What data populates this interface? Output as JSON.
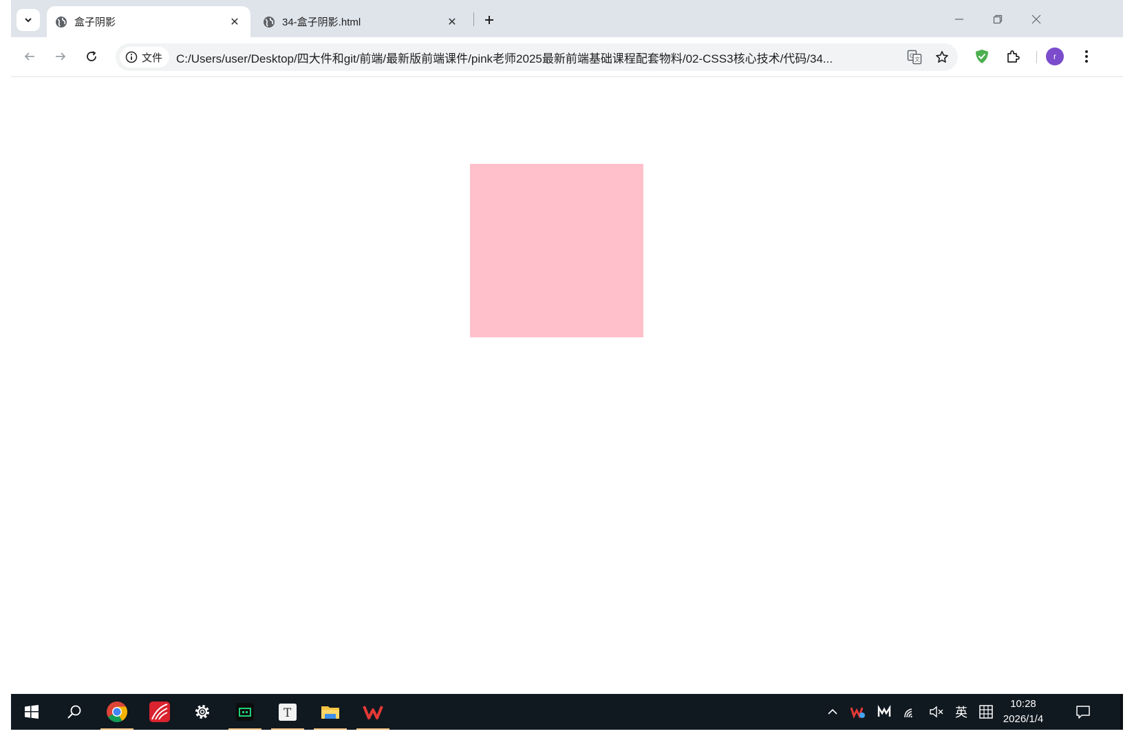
{
  "browser": {
    "tabs": [
      {
        "title": "盒子阴影",
        "active": true
      },
      {
        "title": "34-盒子阴影.html",
        "active": false
      }
    ],
    "address": {
      "chip_label": "文件",
      "url": "C:/Users/user/Desktop/四大件和git/前端/最新版前端课件/pink老师2025最新前端基础课程配套物料/02-CSS3核心技术/代码/34..."
    },
    "profile_initial": "r"
  },
  "page": {
    "box_color": "#ffc0cb"
  },
  "taskbar": {
    "ime_label": "英",
    "time": "10:28",
    "date": "2026/1/4"
  }
}
